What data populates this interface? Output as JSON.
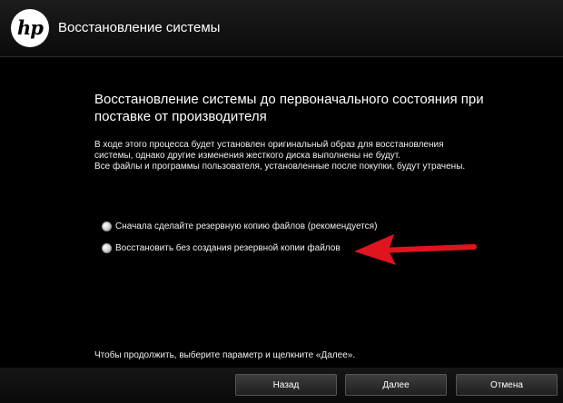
{
  "header": {
    "logo_text": "hp",
    "title": "Восстановление системы"
  },
  "main": {
    "heading_line1": "Восстановление системы до первоначального состояния при",
    "heading_line2": "поставке от производителя",
    "description_lines": [
      "В ходе этого процесса будет установлен оригинальный образ для восстановления",
      "системы, однако другие изменения жесткого диска выполнены не будут.",
      "Все файлы и программы пользователя, установленные после покупки, будут утрачены."
    ],
    "options": [
      {
        "label": "Сначала сделайте резервную копию файлов (рекомендуется)"
      },
      {
        "label": "Восстановить без создания резервной копии файлов"
      }
    ],
    "arrow_color": "#e0141e"
  },
  "footer": {
    "instruction": "Чтобы продолжить, выберите параметр и щелкните «Далее».",
    "buttons": {
      "back": "Назад",
      "next": "Далее",
      "cancel": "Отмена"
    }
  }
}
